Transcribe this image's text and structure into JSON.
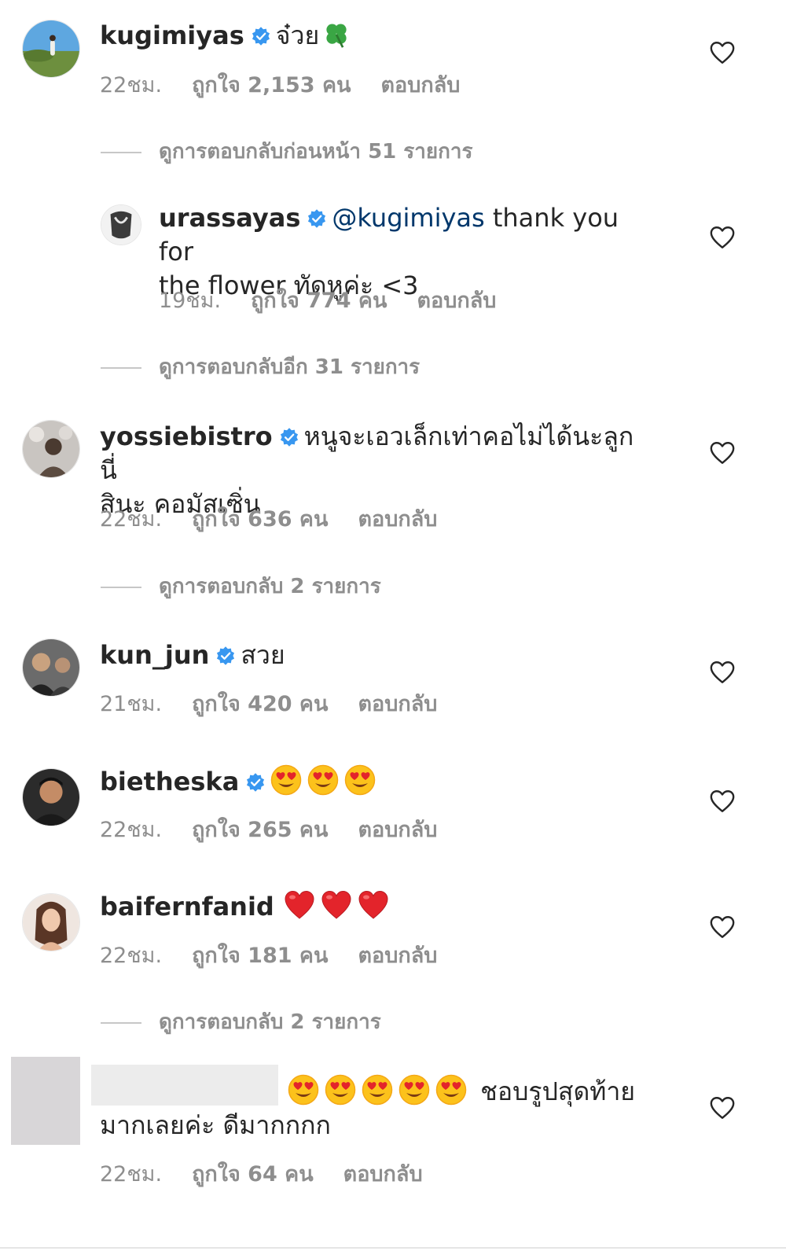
{
  "comments": [
    {
      "username": "kugimiyas",
      "text": "จ๋วย",
      "time": "22ชม.",
      "likes": "ถูกใจ 2,153 คน",
      "reply": "ตอบกลับ",
      "view_replies": "ดูการตอบกลับก่อนหน้า 51 รายการ"
    },
    {
      "username": "urassayas",
      "mention": "@kugimiyas",
      "text_line1": "thank you for",
      "text_line2": "the flower ทัดหูค่ะ <3",
      "time": "19ชม.",
      "likes": "ถูกใจ 774 คน",
      "reply": "ตอบกลับ",
      "view_replies": "ดูการตอบกลับอีก 31 รายการ"
    },
    {
      "username": "yossiebistro",
      "text_line1": "หนูจะเอวเล็กเท่าคอไม่ได้นะลูก นี่",
      "text_line2": "สินะ คอมัสเซิ่น",
      "time": "22ชม.",
      "likes": "ถูกใจ 636 คน",
      "reply": "ตอบกลับ",
      "view_replies": "ดูการตอบกลับ 2 รายการ"
    },
    {
      "username": "kun_jun",
      "text": "สวย",
      "time": "21ชม.",
      "likes": "ถูกใจ 420 คน",
      "reply": "ตอบกลับ"
    },
    {
      "username": "bietheska",
      "emoji": [
        "heart-eyes",
        "heart-eyes",
        "heart-eyes"
      ],
      "time": "22ชม.",
      "likes": "ถูกใจ 265 คน",
      "reply": "ตอบกลับ"
    },
    {
      "username": "baifernfanid",
      "emoji": [
        "red-heart",
        "red-heart",
        "red-heart"
      ],
      "time": "22ชม.",
      "likes": "ถูกใจ 181 คน",
      "reply": "ตอบกลับ",
      "view_replies": "ดูการตอบกลับ 2 รายการ"
    },
    {
      "username": "",
      "emoji": [
        "heart-eyes",
        "heart-eyes",
        "heart-eyes",
        "heart-eyes",
        "heart-eyes"
      ],
      "text_line1": "ชอบรูปสุดท้าย",
      "text_line2": "มากเลยค่ะ ดีมากกกก",
      "time": "22ชม.",
      "likes": "ถูกใจ 64 คน",
      "reply": "ตอบกลับ"
    }
  ],
  "colors": {
    "text": "#262626",
    "secondary": "#8e8e8e",
    "mention": "#00376b",
    "verified": "#3897f0"
  }
}
